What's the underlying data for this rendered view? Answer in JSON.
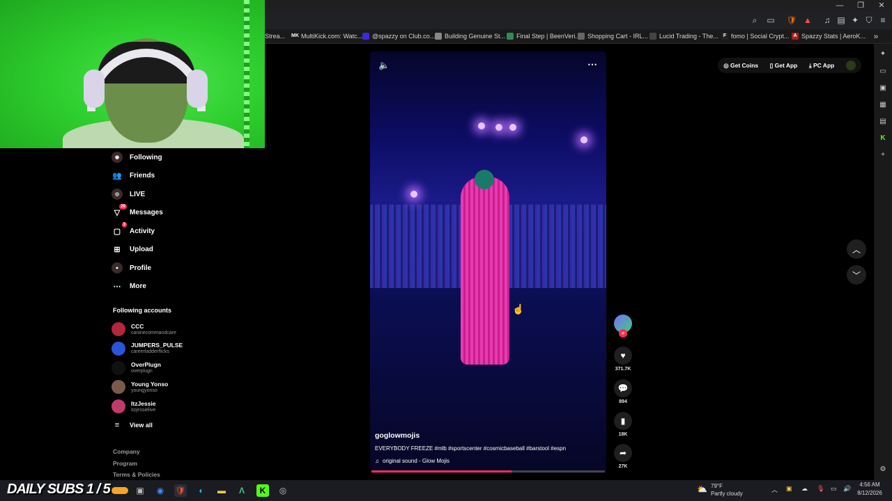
{
  "bookmarks": [
    {
      "label": "Strea...",
      "color": "#9146ff",
      "glyph": ""
    },
    {
      "label": "MultiKick.com: Watc...",
      "color": "#1a1a1a",
      "glyph": "MK"
    },
    {
      "label": "@spazzy on Club.co...",
      "color": "#3a2bd6",
      "glyph": ""
    },
    {
      "label": "Building Genuine St...",
      "color": "#888888",
      "glyph": ""
    },
    {
      "label": "Final Step | BeenVeri...",
      "color": "#2e8b57",
      "glyph": ""
    },
    {
      "label": "Shopping Cart - IRL...",
      "color": "#666666",
      "glyph": ""
    },
    {
      "label": "Lucid Trading - The...",
      "color": "#444444",
      "glyph": ""
    },
    {
      "label": "fomo | Social Crypt...",
      "color": "#222222",
      "glyph": "F"
    },
    {
      "label": "Spazzy Stats | AeroK...",
      "color": "#b31b1b",
      "glyph": "A"
    }
  ],
  "sidebar": {
    "nav": [
      {
        "label": "Following",
        "icon": "following-icon",
        "badge": ""
      },
      {
        "label": "Friends",
        "icon": "friends-icon",
        "badge": ""
      },
      {
        "label": "LIVE",
        "icon": "live-icon",
        "badge": ""
      },
      {
        "label": "Messages",
        "icon": "messages-icon",
        "badge": "20"
      },
      {
        "label": "Activity",
        "icon": "activity-icon",
        "badge": "3"
      },
      {
        "label": "Upload",
        "icon": "upload-icon",
        "badge": ""
      },
      {
        "label": "Profile",
        "icon": "profile-icon",
        "badge": ""
      },
      {
        "label": "More",
        "icon": "more-icon",
        "badge": ""
      }
    ],
    "following_header": "Following accounts",
    "accounts": [
      {
        "name": "CCC",
        "handle": "caninecommandcare",
        "color": "#b3263b"
      },
      {
        "name": "JUMPERS_PULSE",
        "handle": "careerladderflicks",
        "color": "#2a55d6"
      },
      {
        "name": "OverPlugn",
        "handle": "overplugn",
        "color": "#111111"
      },
      {
        "name": "Young Yonso",
        "handle": "youngyonso",
        "color": "#7a5a4a"
      },
      {
        "name": "ItzJessie",
        "handle": "itzjessielive",
        "color": "#c23a6a"
      }
    ],
    "view_all": "View all",
    "footer": [
      "Company",
      "Program",
      "Terms & Policies"
    ]
  },
  "video": {
    "username": "goglowmojis",
    "caption": "EVERYBODY FREEZE #mlb #sportscenter #cosmicbaseball #barstool #espn",
    "sound": "original sound - Glow Mojis",
    "progress": 0.6
  },
  "actions": {
    "likes": "371.7K",
    "comments": "894",
    "saves": "18K",
    "shares": "27K"
  },
  "top_links": {
    "coins": "Get Coins",
    "app": "Get App",
    "pc": "PC App"
  },
  "taskbar": {
    "overlay": "DAILY SUBS 1 / 5",
    "temp": "79°F",
    "weather": "Partly cloudy",
    "time": "4:56 AM",
    "date": "8/12/2026"
  },
  "colors": {
    "accent": "#fe2c55",
    "greenscreen": "#2ecf2e"
  }
}
